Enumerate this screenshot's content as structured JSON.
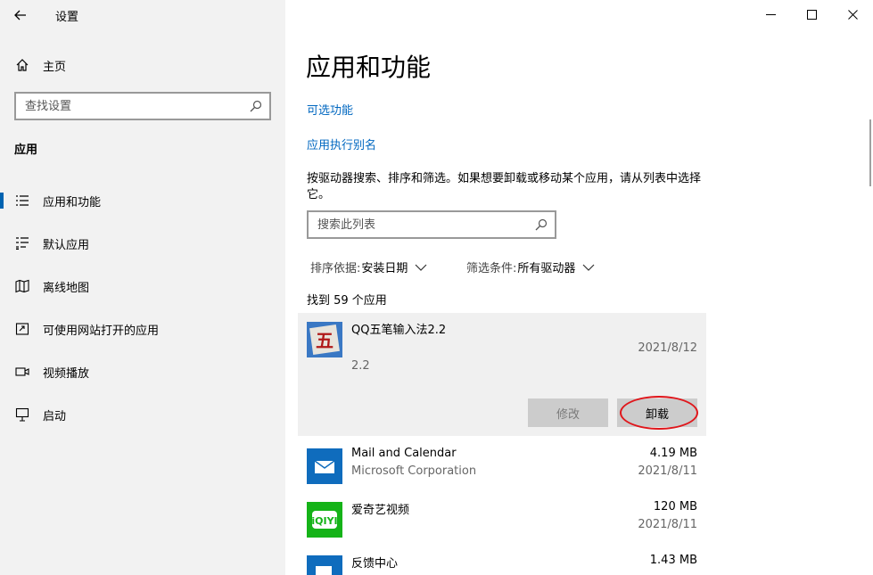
{
  "window": {
    "title": "设置"
  },
  "sidebar": {
    "home_label": "主页",
    "search_placeholder": "查找设置",
    "section": "应用",
    "items": [
      {
        "label": "应用和功能",
        "icon": "list-icon",
        "active": true
      },
      {
        "label": "默认应用",
        "icon": "default-apps-icon"
      },
      {
        "label": "离线地图",
        "icon": "map-icon"
      },
      {
        "label": "可使用网站打开的应用",
        "icon": "open-with-web-icon"
      },
      {
        "label": "视频播放",
        "icon": "video-icon"
      },
      {
        "label": "启动",
        "icon": "startup-icon"
      }
    ]
  },
  "main": {
    "title": "应用和功能",
    "links": [
      "可选功能",
      "应用执行别名"
    ],
    "description": "按驱动器搜索、排序和筛选。如果想要卸载或移动某个应用，请从列表中选择它。",
    "list_search_placeholder": "搜索此列表",
    "sort": {
      "label": "排序依据:",
      "value": "安装日期"
    },
    "filter": {
      "label": "筛选条件:",
      "value": "所有驱动器"
    },
    "count_text": "找到 59 个应用",
    "apps": [
      {
        "name": "QQ五笔输入法2.2",
        "publisher": "",
        "size": "",
        "date": "2021/8/12",
        "version": "2.2",
        "selected": true
      },
      {
        "name": "Mail and Calendar",
        "publisher": "Microsoft Corporation",
        "size": "4.19 MB",
        "date": "2021/8/11"
      },
      {
        "name": "爱奇艺视频",
        "publisher": "",
        "size": "120 MB",
        "date": "2021/8/11"
      },
      {
        "name": "反馈中心",
        "publisher": "",
        "size": "1.43 MB",
        "date": ""
      }
    ],
    "buttons": {
      "modify": "修改",
      "uninstall": "卸载"
    },
    "icon_texts": {
      "qq_char": "五",
      "iqiyi": "iQIYI"
    }
  },
  "colors": {
    "accent": "#0067c0",
    "sidebar_bg": "#f2f2f2",
    "selected_bg": "#f0f0f0",
    "annotation": "#e0161b"
  }
}
